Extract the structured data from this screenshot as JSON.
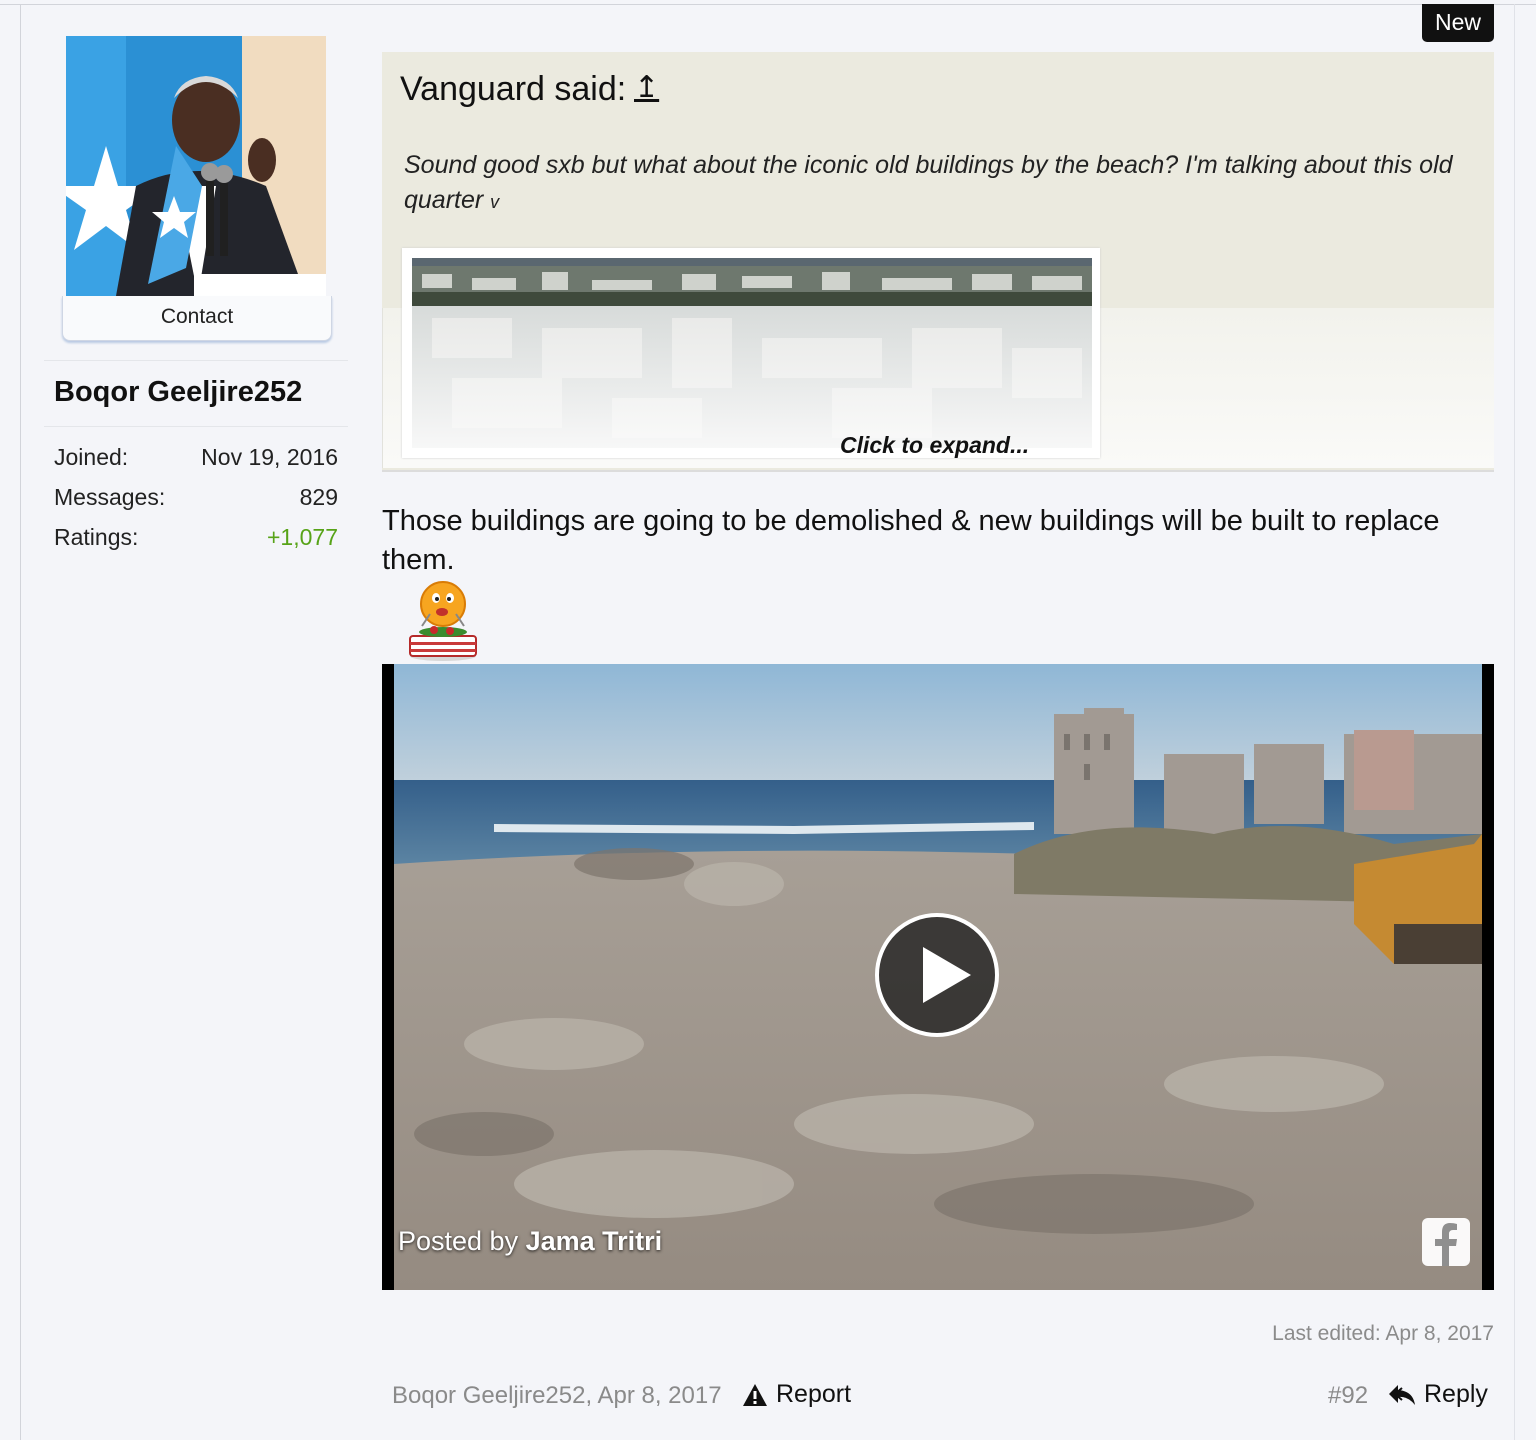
{
  "badge": {
    "new_label": "New"
  },
  "user": {
    "avatar_icon": "avatar",
    "contact_label": "Contact",
    "name": "Boqor Geeljire252",
    "stats": [
      {
        "label": "Joined:",
        "value": "Nov 19, 2016"
      },
      {
        "label": "Messages:",
        "value": "829"
      },
      {
        "label": "Ratings:",
        "value": "+1,077"
      }
    ],
    "ratings_color": "#57a318"
  },
  "quote": {
    "author": "Vanguard said:",
    "up_glyph": "↥",
    "text": "Sound good sxb but what about the iconic old buildings by the beach? I'm talking about this old quarter ",
    "expand_glyph": "v",
    "image_icon": "city-photo",
    "click_to_expand": "Click to expand..."
  },
  "message": {
    "text": "Those buildings are going to be demolished & new buildings will be built to replace them.",
    "smiley_icon": "eating-smiley-icon"
  },
  "video": {
    "posted_prefix": "Posted by",
    "posted_author": "Jama Tritri",
    "play_icon": "play-icon",
    "facebook_icon": "facebook-icon"
  },
  "footer": {
    "last_edited": "Last edited: Apr 8, 2017",
    "meta": "Boqor Geeljire252, Apr 8, 2017",
    "report_label": "Report",
    "post_number": "#92",
    "reply_label": "Reply"
  }
}
